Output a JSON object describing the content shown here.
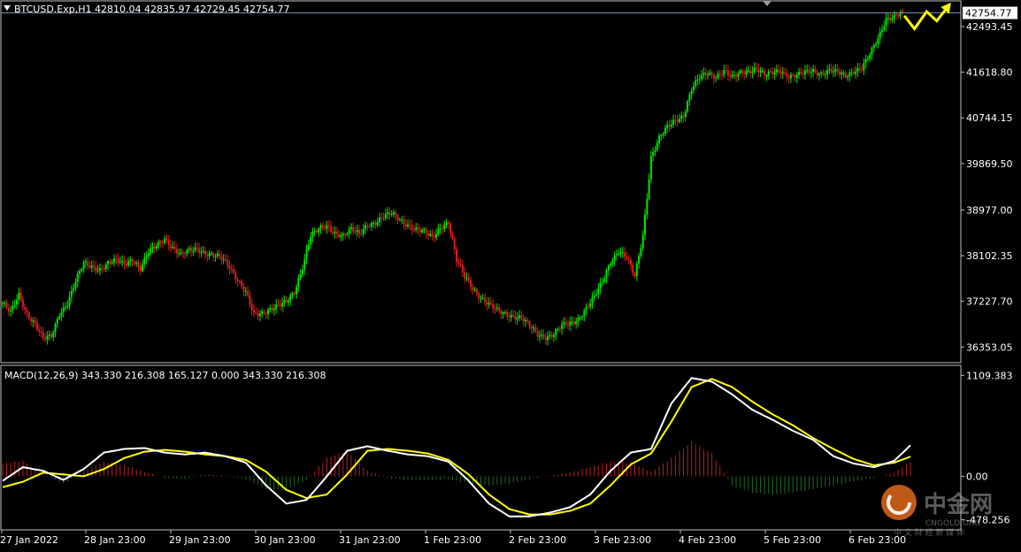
{
  "colors": {
    "background": "#000000",
    "frame": "#c0c0c0",
    "bull_candle": "#00e400",
    "bear_candle": "#d82020",
    "macd_line": "#ffffff",
    "signal_line": "#ffff00",
    "hist_pos": "#b22222",
    "hist_neg": "#1f6b1f",
    "projection_arrow": "#ffff00"
  },
  "header": {
    "title": "BTCUSD.Exp,H1  42810.04 42835.97 42729.45 42754.77",
    "collapse_icon": "triangle-down-icon"
  },
  "indicator_header": "MACD(12,26,9) 343.330 216.308 165.127 0.000 343.330 216.308",
  "watermark": {
    "name": "中金网",
    "domain": "CNGOLD.ORG",
    "tagline": "中 文 财 经 新 媒 体",
    "logo_icon": "cngold-logo-icon"
  },
  "chart_data": [
    {
      "type": "candlestick",
      "symbol": "BTCUSD.Exp",
      "timeframe": "H1",
      "ohlc_last": {
        "open": 42810.04,
        "high": 42835.97,
        "low": 42729.45,
        "close": 42754.77
      },
      "current_price_label": "42754.77",
      "y_ticks": [
        "42493.45",
        "41618.80",
        "40744.15",
        "39869.50",
        "38977.00",
        "38102.35",
        "37227.70",
        "36353.05"
      ],
      "ylim": [
        36120,
        42900
      ],
      "x_ticks": [
        "27 Jan 2022",
        "28 Jan 23:00",
        "29 Jan 23:00",
        "30 Jan 23:00",
        "31 Jan 23:00",
        "1 Feb 23:00",
        "2 Feb 23:00",
        "3 Feb 23:00",
        "4 Feb 23:00",
        "5 Feb 23:00",
        "6 Feb 23:00"
      ],
      "close_path": [
        [
          0,
          37200
        ],
        [
          4,
          37000
        ],
        [
          8,
          37350
        ],
        [
          12,
          37000
        ],
        [
          16,
          36800
        ],
        [
          20,
          36500
        ],
        [
          24,
          36550
        ],
        [
          28,
          37000
        ],
        [
          32,
          37200
        ],
        [
          36,
          37600
        ],
        [
          40,
          37950
        ],
        [
          44,
          37900
        ],
        [
          48,
          37850
        ],
        [
          52,
          37950
        ],
        [
          56,
          38000
        ],
        [
          60,
          37950
        ],
        [
          64,
          38050
        ],
        [
          68,
          37850
        ],
        [
          72,
          38150
        ],
        [
          76,
          38300
        ],
        [
          80,
          38450
        ],
        [
          84,
          38250
        ],
        [
          88,
          38100
        ],
        [
          92,
          38200
        ],
        [
          96,
          38250
        ],
        [
          100,
          38150
        ],
        [
          104,
          38100
        ],
        [
          108,
          38050
        ],
        [
          112,
          37900
        ],
        [
          116,
          37650
        ],
        [
          120,
          37400
        ],
        [
          124,
          36950
        ],
        [
          128,
          37000
        ],
        [
          132,
          37100
        ],
        [
          136,
          37150
        ],
        [
          140,
          37200
        ],
        [
          144,
          37400
        ],
        [
          148,
          37900
        ],
        [
          152,
          38500
        ],
        [
          156,
          38600
        ],
        [
          160,
          38650
        ],
        [
          164,
          38550
        ],
        [
          168,
          38500
        ],
        [
          172,
          38600
        ],
        [
          176,
          38500
        ],
        [
          180,
          38700
        ],
        [
          184,
          38750
        ],
        [
          188,
          38850
        ],
        [
          192,
          38900
        ],
        [
          196,
          38800
        ],
        [
          200,
          38700
        ],
        [
          204,
          38600
        ],
        [
          208,
          38550
        ],
        [
          212,
          38450
        ],
        [
          216,
          38650
        ],
        [
          220,
          38750
        ],
        [
          224,
          38000
        ],
        [
          228,
          37700
        ],
        [
          232,
          37500
        ],
        [
          236,
          37300
        ],
        [
          240,
          37150
        ],
        [
          244,
          37050
        ],
        [
          248,
          37000
        ],
        [
          252,
          36950
        ],
        [
          256,
          36900
        ],
        [
          260,
          36750
        ],
        [
          264,
          36600
        ],
        [
          268,
          36550
        ],
        [
          272,
          36600
        ],
        [
          276,
          36750
        ],
        [
          280,
          36800
        ],
        [
          284,
          36900
        ],
        [
          288,
          37100
        ],
        [
          292,
          37300
        ],
        [
          296,
          37600
        ],
        [
          300,
          38000
        ],
        [
          304,
          38200
        ],
        [
          308,
          38050
        ],
        [
          312,
          37700
        ],
        [
          316,
          38500
        ],
        [
          320,
          40000
        ],
        [
          324,
          40350
        ],
        [
          328,
          40550
        ],
        [
          332,
          40700
        ],
        [
          336,
          40800
        ],
        [
          340,
          41300
        ],
        [
          344,
          41500
        ],
        [
          348,
          41600
        ],
        [
          352,
          41550
        ],
        [
          356,
          41650
        ],
        [
          360,
          41500
        ],
        [
          364,
          41600
        ],
        [
          368,
          41650
        ],
        [
          372,
          41700
        ],
        [
          376,
          41550
        ],
        [
          380,
          41600
        ],
        [
          384,
          41650
        ],
        [
          388,
          41550
        ],
        [
          392,
          41550
        ],
        [
          396,
          41600
        ],
        [
          400,
          41650
        ],
        [
          404,
          41600
        ],
        [
          408,
          41650
        ],
        [
          412,
          41600
        ],
        [
          416,
          41550
        ],
        [
          420,
          41650
        ],
        [
          424,
          41700
        ],
        [
          428,
          41950
        ],
        [
          432,
          42250
        ],
        [
          436,
          42650
        ],
        [
          440,
          42700
        ],
        [
          444,
          42754.77
        ]
      ],
      "projection_arrow": [
        [
          445,
          42700
        ],
        [
          450,
          42450
        ],
        [
          456,
          42780
        ],
        [
          461,
          42600
        ],
        [
          468,
          42950
        ]
      ]
    },
    {
      "type": "macd",
      "name": "MACD(12,26,9)",
      "values": {
        "histogram": 343.33,
        "signal": 216.308
      },
      "y_ticks": [
        "1109.383",
        "0.00",
        "-478.256"
      ],
      "ylim": [
        -560,
        1180
      ],
      "macd_path": [
        [
          0,
          -50
        ],
        [
          10,
          100
        ],
        [
          20,
          60
        ],
        [
          30,
          -40
        ],
        [
          40,
          80
        ],
        [
          50,
          260
        ],
        [
          60,
          300
        ],
        [
          70,
          310
        ],
        [
          80,
          260
        ],
        [
          90,
          240
        ],
        [
          100,
          260
        ],
        [
          110,
          220
        ],
        [
          120,
          150
        ],
        [
          130,
          -100
        ],
        [
          140,
          -300
        ],
        [
          150,
          -260
        ],
        [
          160,
          0
        ],
        [
          170,
          280
        ],
        [
          180,
          330
        ],
        [
          190,
          280
        ],
        [
          200,
          240
        ],
        [
          210,
          220
        ],
        [
          220,
          160
        ],
        [
          230,
          -50
        ],
        [
          240,
          -300
        ],
        [
          250,
          -440
        ],
        [
          260,
          -440
        ],
        [
          270,
          -400
        ],
        [
          280,
          -340
        ],
        [
          290,
          -200
        ],
        [
          300,
          60
        ],
        [
          310,
          260
        ],
        [
          320,
          300
        ],
        [
          330,
          800
        ],
        [
          340,
          1080
        ],
        [
          350,
          1040
        ],
        [
          360,
          900
        ],
        [
          370,
          730
        ],
        [
          380,
          620
        ],
        [
          390,
          500
        ],
        [
          400,
          400
        ],
        [
          410,
          220
        ],
        [
          420,
          140
        ],
        [
          430,
          100
        ],
        [
          440,
          170
        ],
        [
          448,
          340
        ]
      ],
      "signal_path": [
        [
          0,
          -120
        ],
        [
          10,
          -60
        ],
        [
          20,
          40
        ],
        [
          30,
          20
        ],
        [
          40,
          0
        ],
        [
          50,
          80
        ],
        [
          60,
          200
        ],
        [
          70,
          270
        ],
        [
          80,
          290
        ],
        [
          90,
          270
        ],
        [
          100,
          240
        ],
        [
          110,
          220
        ],
        [
          120,
          180
        ],
        [
          130,
          50
        ],
        [
          140,
          -150
        ],
        [
          150,
          -240
        ],
        [
          160,
          -200
        ],
        [
          170,
          20
        ],
        [
          180,
          280
        ],
        [
          190,
          300
        ],
        [
          200,
          280
        ],
        [
          210,
          250
        ],
        [
          220,
          180
        ],
        [
          230,
          20
        ],
        [
          240,
          -200
        ],
        [
          250,
          -360
        ],
        [
          260,
          -420
        ],
        [
          270,
          -420
        ],
        [
          280,
          -380
        ],
        [
          290,
          -300
        ],
        [
          300,
          -100
        ],
        [
          310,
          130
        ],
        [
          320,
          250
        ],
        [
          330,
          600
        ],
        [
          340,
          980
        ],
        [
          350,
          1070
        ],
        [
          360,
          980
        ],
        [
          370,
          820
        ],
        [
          380,
          680
        ],
        [
          390,
          560
        ],
        [
          400,
          420
        ],
        [
          410,
          300
        ],
        [
          420,
          190
        ],
        [
          430,
          120
        ],
        [
          440,
          150
        ],
        [
          448,
          216
        ]
      ],
      "histogram_path": [
        [
          0,
          140
        ],
        [
          10,
          170
        ],
        [
          20,
          20
        ],
        [
          30,
          -80
        ],
        [
          40,
          60
        ],
        [
          50,
          160
        ],
        [
          60,
          120
        ],
        [
          70,
          50
        ],
        [
          80,
          -20
        ],
        [
          90,
          -30
        ],
        [
          100,
          20
        ],
        [
          110,
          10
        ],
        [
          120,
          -30
        ],
        [
          130,
          -140
        ],
        [
          140,
          -150
        ],
        [
          150,
          -40
        ],
        [
          160,
          200
        ],
        [
          170,
          280
        ],
        [
          180,
          60
        ],
        [
          190,
          -20
        ],
        [
          200,
          -40
        ],
        [
          210,
          -40
        ],
        [
          220,
          -30
        ],
        [
          230,
          -80
        ],
        [
          240,
          -100
        ],
        [
          250,
          -80
        ],
        [
          260,
          -30
        ],
        [
          270,
          10
        ],
        [
          280,
          40
        ],
        [
          290,
          100
        ],
        [
          300,
          160
        ],
        [
          310,
          150
        ],
        [
          320,
          50
        ],
        [
          330,
          200
        ],
        [
          340,
          380
        ],
        [
          350,
          250
        ],
        [
          360,
          -100
        ],
        [
          370,
          -180
        ],
        [
          380,
          -200
        ],
        [
          390,
          -180
        ],
        [
          400,
          -140
        ],
        [
          410,
          -100
        ],
        [
          420,
          -60
        ],
        [
          430,
          -20
        ],
        [
          440,
          40
        ],
        [
          448,
          160
        ]
      ]
    }
  ]
}
